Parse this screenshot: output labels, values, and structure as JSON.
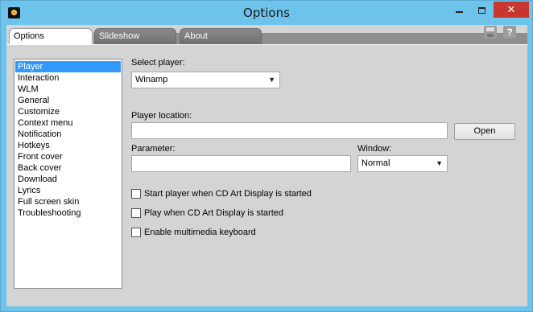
{
  "window": {
    "title": "Options",
    "close_glyph": "✕"
  },
  "tabs": [
    {
      "label": "Options",
      "active": true
    },
    {
      "label": "Slideshow",
      "active": false
    },
    {
      "label": "About",
      "active": false
    }
  ],
  "toolbar": {
    "save_icon": "save-icon",
    "help_glyph": "?"
  },
  "nav": {
    "items": [
      "Player",
      "Interaction",
      "WLM",
      "General",
      "Customize",
      "Context menu",
      "Notification",
      "Hotkeys",
      "Front cover",
      "Back cover",
      "Download",
      "Lyrics",
      "Full screen skin",
      "Troubleshooting"
    ],
    "selected": "Player"
  },
  "form": {
    "select_player_label": "Select player:",
    "select_player_value": "Winamp",
    "player_location_label": "Player location:",
    "player_location_value": "",
    "open_button": "Open",
    "parameter_label": "Parameter:",
    "parameter_value": "",
    "window_label": "Window:",
    "window_value": "Normal",
    "checkboxes": [
      {
        "label": "Start player when CD Art Display is started",
        "checked": false
      },
      {
        "label": "Play when CD Art Display is started",
        "checked": false
      },
      {
        "label": "Enable multimedia keyboard",
        "checked": false
      }
    ]
  },
  "colors": {
    "titlebar": "#6dc3ea",
    "close_button": "#c7372f",
    "selection": "#3399ff"
  }
}
